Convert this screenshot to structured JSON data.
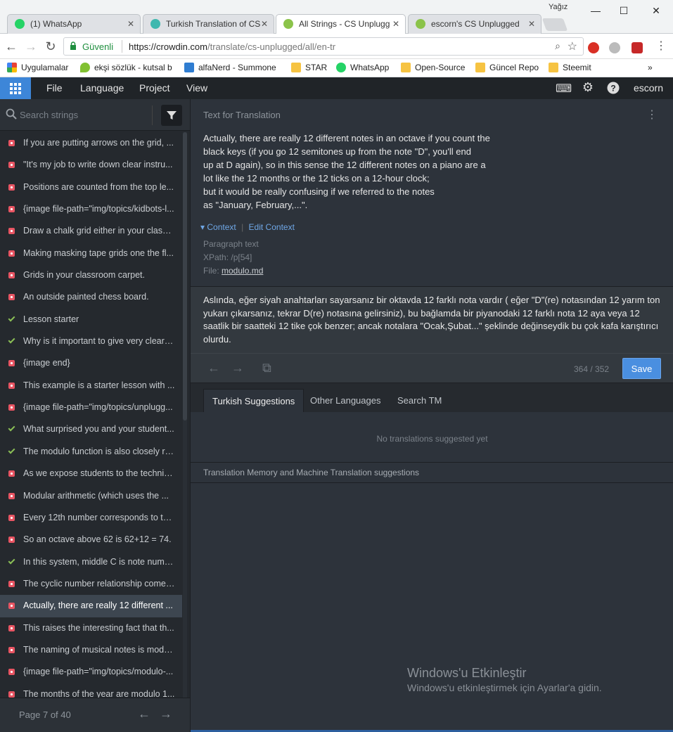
{
  "window": {
    "user": "Yağız",
    "minimize": "—",
    "maximize": "☐",
    "close": "✕"
  },
  "tabs": [
    {
      "title": "(1) WhatsApp",
      "icon_color": "#25d366"
    },
    {
      "title": "Turkish Translation of CS",
      "icon_color": "#3fb8af"
    },
    {
      "title": "All Strings - CS Unplugg",
      "icon_color": "#8bc34a"
    },
    {
      "title": "escorn's CS Unplugged",
      "icon_color": "#8bc34a"
    }
  ],
  "address": {
    "secure_label": "Güvenli",
    "url_host": "https://crowdin.com",
    "url_path": "/translate/cs-unplugged/all/en-tr"
  },
  "bookmarks": [
    {
      "label": "Uygulamalar",
      "color": "#e94235"
    },
    {
      "label": "ekşi sözlük - kutsal b",
      "color": "#81c132"
    },
    {
      "label": "alfaNerd - Summone",
      "color": "#2f7dd1"
    },
    {
      "label": "STAR",
      "color": "#f6c342"
    },
    {
      "label": "WhatsApp",
      "color": "#25d366"
    },
    {
      "label": "Open-Source",
      "color": "#f6c342"
    },
    {
      "label": "Güncel Repo",
      "color": "#f6c342"
    },
    {
      "label": "Steemit",
      "color": "#f6c342"
    }
  ],
  "bookmarks_more": "»",
  "app_menu": {
    "file": "File",
    "language": "Language",
    "project": "Project",
    "view": "View",
    "username": "escorn"
  },
  "sidebar": {
    "search_placeholder": "Search strings",
    "page_label": "Page 7 of 40",
    "items": [
      {
        "text": "If you are putting arrows on the grid, ...",
        "status": "untr"
      },
      {
        "text": "\"It's my job to write down clear instru...",
        "status": "untr"
      },
      {
        "text": "Positions are counted from the top le...",
        "status": "untr"
      },
      {
        "text": "{image file-path=\"img/topics/kidbots-l...",
        "status": "untr"
      },
      {
        "text": "Draw a chalk grid either in your classr...",
        "status": "untr"
      },
      {
        "text": "Making masking tape grids one the fl...",
        "status": "untr"
      },
      {
        "text": "Grids in your classroom carpet.",
        "status": "untr"
      },
      {
        "text": "An outside painted chess board.",
        "status": "untr"
      },
      {
        "text": "Lesson starter",
        "status": "done"
      },
      {
        "text": "Why is it important to give very clear i...",
        "status": "done"
      },
      {
        "text": "{image end}",
        "status": "untr"
      },
      {
        "text": "This example is a starter lesson with ...",
        "status": "untr"
      },
      {
        "text": "{image file-path=\"img/topics/unplugg...",
        "status": "untr"
      },
      {
        "text": "What surprised you and your student...",
        "status": "done"
      },
      {
        "text": "The modulo function is also closely re...",
        "status": "done"
      },
      {
        "text": "As we expose students to the technic...",
        "status": "untr"
      },
      {
        "text": "Modular arithmetic (which uses the ...",
        "status": "untr"
      },
      {
        "text": "Every 12th number corresponds to th...",
        "status": "untr"
      },
      {
        "text": "So an octave above 62 is 62+12 = 74.",
        "status": "untr"
      },
      {
        "text": "In this system, middle C is note numb...",
        "status": "done"
      },
      {
        "text": "The cyclic number relationship comes...",
        "status": "untr"
      },
      {
        "text": "Actually, there are really 12 different ...",
        "status": "untr",
        "active": true
      },
      {
        "text": "This raises the interesting fact that th...",
        "status": "untr"
      },
      {
        "text": "The naming of musical notes is modu...",
        "status": "untr"
      },
      {
        "text": "{image file-path=\"img/topics/modulo-...",
        "status": "untr"
      },
      {
        "text": "The months of the year are modulo 1...",
        "status": "untr"
      }
    ]
  },
  "source": {
    "label": "Text for Translation",
    "lines": [
      "Actually, there are really 12 different notes in an octave if you count the",
      "black keys (if you go 12 semitones up from the note \"D\", you'll end",
      "up at D again), so in this sense the 12 different notes on a piano are a",
      "lot like the 12 months or the 12 ticks on a 12-hour clock;",
      "but it would be really confusing if we referred to the notes",
      "as \"January, February,...\"."
    ],
    "context_toggle": "Context",
    "edit_context": "Edit Context",
    "para_label": "Paragraph text",
    "xpath": "XPath: /p[54]",
    "file_label": "File:",
    "file_name": "modulo.md"
  },
  "translation": {
    "text": "Aslında, eğer siyah anahtarları sayarsanız bir oktavda 12 farklı nota vardır  ( eğer \"D\"(re) notasından 12 yarım ton yukarı çıkarsanız, tekrar D(re) notasına gelirsiniz), bu bağlamda bir piyanodaki 12 farklı nota 12 aya veya 12 saatlik bir saatteki 12 tike çok benzer; ancak notalara \"Ocak,Şubat...\" şeklinde değinseydik bu çok kafa karıştırıcı olurdu.",
    "count": "364 / 352",
    "save": "Save"
  },
  "suggestion_tabs": [
    "Turkish Suggestions",
    "Other Languages",
    "Search TM"
  ],
  "no_suggestions": "No translations suggested yet",
  "tm_label": "Translation Memory and Machine Translation suggestions",
  "watermark": {
    "title": "Windows'u Etkinleştir",
    "subtitle": "Windows'u etkinleştirmek için Ayarlar'a gidin."
  }
}
